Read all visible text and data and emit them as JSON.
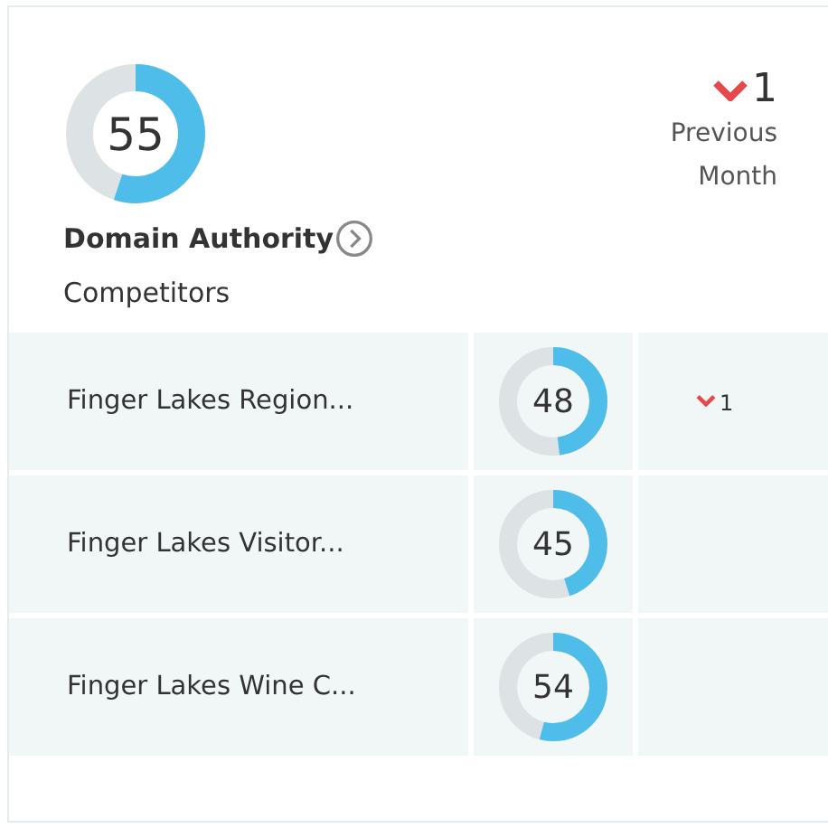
{
  "domain_authority": {
    "score": "55",
    "label": "Domain Authority",
    "change": {
      "decreased": true,
      "value": "1"
    },
    "change_caption": "Previous Month"
  },
  "competitors": {
    "heading": "Competitors",
    "rows": [
      {
        "name": "Finger Lakes Region...",
        "score": "48",
        "change": {
          "decreased": true,
          "value": "1"
        }
      },
      {
        "name": "Finger Lakes Visitor...",
        "score": "45"
      },
      {
        "name": "Finger Lakes Wine C...",
        "score": "54"
      }
    ]
  }
}
